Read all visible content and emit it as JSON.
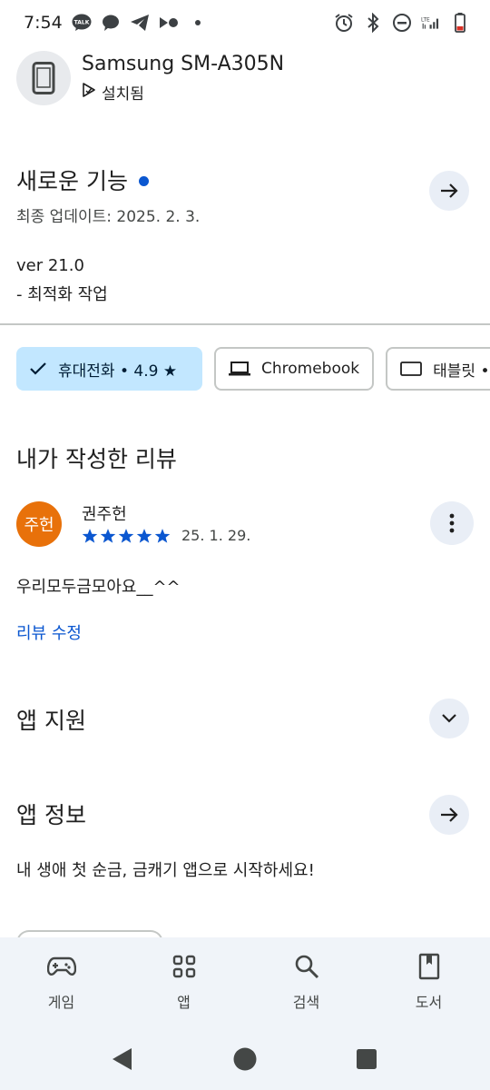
{
  "status_bar": {
    "time": "7:54",
    "left_icons": [
      "kakaotalk-icon",
      "chat-bubble-icon",
      "telegram-icon",
      "media-dots-icon",
      "dot-icon"
    ],
    "right_icons": [
      "alarm-icon",
      "bluetooth-icon",
      "do-not-disturb-icon",
      "lte-signal-icon",
      "battery-low-icon"
    ],
    "kakao_label": "TALK",
    "lte_label": "LTE"
  },
  "device": {
    "name": "Samsung SM-A305N",
    "status": "설치됨"
  },
  "whats_new": {
    "title": "새로운 기능",
    "last_updated": "최종 업데이트: 2025. 2. 3.",
    "version": "ver 21.0",
    "notes": "- 최적화 작업"
  },
  "chips": [
    {
      "label": "휴대전화 • 4.9 ★",
      "icon": "check-icon",
      "selected": true
    },
    {
      "label": "Chromebook",
      "icon": "laptop-icon",
      "selected": false
    },
    {
      "label": "태블릿 •",
      "icon": "tablet-icon",
      "selected": false
    }
  ],
  "my_review": {
    "section_title": "내가 작성한 리뷰",
    "avatar_text": "주헌",
    "reviewer": "권주헌",
    "rating": 5,
    "date": "25. 1. 29.",
    "text": "우리모두금모아요__^^",
    "edit_label": "리뷰 수정"
  },
  "app_support": {
    "title": "앱 지원"
  },
  "app_info": {
    "title": "앱 정보",
    "description": "내 생애 첫 순금, 금캐기 앱으로 시작하세요!"
  },
  "bottom_nav": [
    {
      "label": "게임",
      "icon": "gamepad-icon"
    },
    {
      "label": "앱",
      "icon": "apps-grid-icon"
    },
    {
      "label": "검색",
      "icon": "search-icon"
    },
    {
      "label": "도서",
      "icon": "book-icon"
    }
  ],
  "colors": {
    "accent": "#0b57d0",
    "chip_selected": "#c2e7ff",
    "avatar": "#e8710a",
    "nav_bg": "#f0f4f9",
    "battery_low": "#d93025"
  }
}
